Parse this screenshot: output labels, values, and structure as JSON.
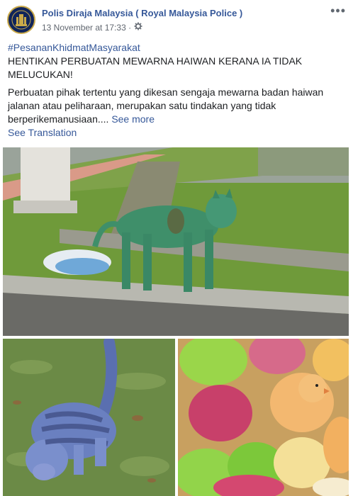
{
  "post": {
    "page_name": "Polis Diraja Malaysia ( Royal Malaysia Police )",
    "timestamp": "13 November at 17:33 ·",
    "audience_icon": "gear-icon",
    "more_options_icon": "more-options-icon",
    "hashtag": "#PesananKhidmatMasyarakat",
    "headline": "HENTIKAN PERBUATAN MEWARNA HAIWAN KERANA IA TIDAK MELUCUKAN!",
    "body": "Perbuatan pihak tertentu yang dikesan sengaja mewarna badan haiwan jalanan atau peliharaan, merupakan satu tindakan yang tidak berperikemanusiaan....",
    "see_more": "See more",
    "see_translation": "See Translation"
  },
  "colors": {
    "link": "#365899",
    "text": "#1c1e21",
    "meta": "#616770"
  },
  "photos": [
    {
      "subject": "green-dyed-dog-photo"
    },
    {
      "subject": "blue-dyed-cat-photo"
    },
    {
      "subject": "dyed-chicks-photo"
    }
  ]
}
